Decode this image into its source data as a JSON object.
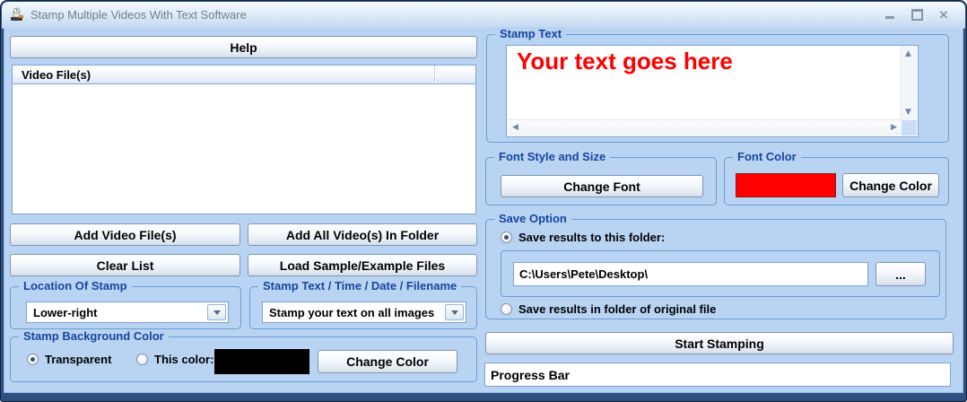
{
  "window": {
    "title": "Stamp Multiple Videos With Text Software"
  },
  "left_panel": {
    "help_button": "Help",
    "file_list": {
      "header": "Video File(s)"
    },
    "buttons": {
      "add_files": "Add Video File(s)",
      "add_folder": "Add All Video(s) In Folder",
      "clear_list": "Clear List",
      "load_samples": "Load Sample/Example Files"
    },
    "location_group": {
      "label": "Location Of Stamp",
      "selected": "Lower-right"
    },
    "stamp_mode_group": {
      "label": "Stamp Text / Time / Date / Filename",
      "selected": "Stamp your text on all images"
    },
    "background_group": {
      "label": "Stamp Background Color",
      "transparent_radio": "Transparent",
      "this_color_radio": "This color:",
      "swatch_color": "#000000",
      "change_color_button": "Change Color"
    }
  },
  "right_panel": {
    "stamp_text_group": {
      "label": "Stamp Text",
      "text": "Your text goes here",
      "text_color": "#ff0000"
    },
    "font_group": {
      "label": "Font Style and Size",
      "change_font_button": "Change Font"
    },
    "font_color_group": {
      "label": "Font Color",
      "swatch_color": "#ff0000",
      "change_color_button": "Change Color"
    },
    "save_group": {
      "label": "Save Option",
      "save_to_folder_radio": "Save results to this folder:",
      "folder_path": "C:\\Users\\Pete\\Desktop\\",
      "browse_button": "...",
      "save_original_radio": "Save results in folder of original file"
    },
    "start_button": "Start Stamping",
    "progress_bar": "Progress Bar"
  }
}
